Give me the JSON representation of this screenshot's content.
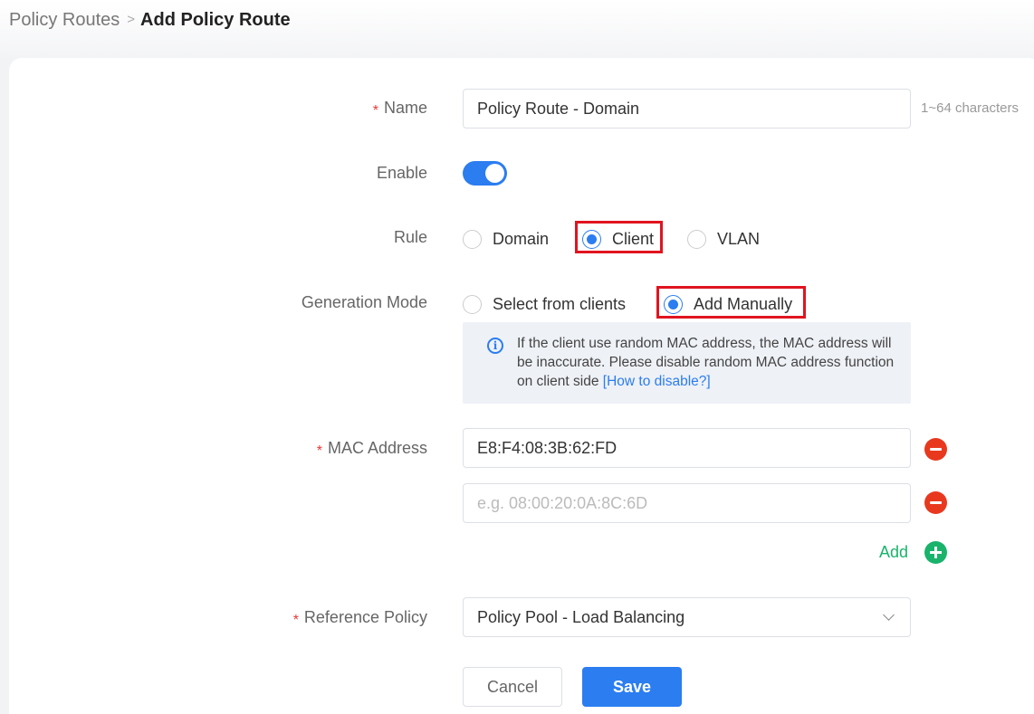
{
  "breadcrumb": {
    "parent": "Policy Routes",
    "separator": ">",
    "current": "Add Policy Route"
  },
  "form": {
    "name": {
      "required_mark": "*",
      "label": "Name",
      "value": "Policy Route - Domain",
      "hint": "1~64 characters"
    },
    "enable": {
      "label": "Enable",
      "on": true
    },
    "rule": {
      "label": "Rule",
      "options": [
        "Domain",
        "Client",
        "VLAN"
      ],
      "selected": "Client"
    },
    "generation_mode": {
      "label": "Generation Mode",
      "options": [
        "Select from clients",
        "Add Manually"
      ],
      "selected": "Add Manually"
    },
    "info": {
      "text": "If the client use random MAC address, the MAC address will be inaccurate. Please disable random MAC address function on client side",
      "link": "[How to disable?]"
    },
    "mac_address": {
      "required_mark": "*",
      "label": "MAC Address",
      "entries": [
        {
          "value": "E8:F4:08:3B:62:FD",
          "placeholder": "e.g. 08:00:20:0A:8C:6D"
        },
        {
          "value": "",
          "placeholder": "e.g. 08:00:20:0A:8C:6D"
        }
      ],
      "add_label": "Add"
    },
    "reference_policy": {
      "required_mark": "*",
      "label": "Reference Policy",
      "value": "Policy Pool - Load Balancing"
    }
  },
  "buttons": {
    "cancel": "Cancel",
    "save": "Save"
  },
  "colors": {
    "primary": "#2b7df0",
    "danger": "#e8391e",
    "success": "#19b36b",
    "highlight": "#e0141f"
  }
}
